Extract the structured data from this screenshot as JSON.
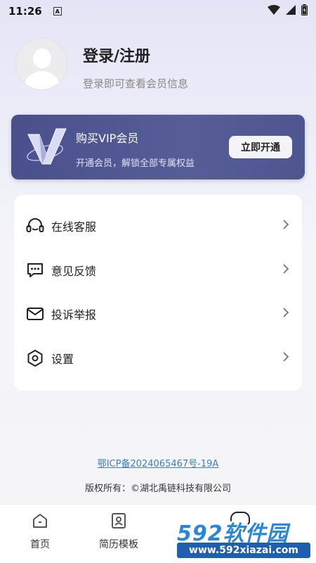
{
  "status_bar": {
    "time": "11:26",
    "a_icon": "A"
  },
  "profile": {
    "title": "登录/注册",
    "subtitle": "登录即可查看会员信息"
  },
  "vip": {
    "title": "购买VIP会员",
    "subtitle": "开通会员，解锁全部专属权益",
    "button_label": "立即开通"
  },
  "menu": {
    "items": [
      {
        "label": "在线客服",
        "icon": "headset-icon"
      },
      {
        "label": "意见反馈",
        "icon": "feedback-icon"
      },
      {
        "label": "投诉举报",
        "icon": "mail-icon"
      },
      {
        "label": "设置",
        "icon": "settings-icon"
      }
    ]
  },
  "footer": {
    "icp": "鄂ICP备2024065467号-19A",
    "copyright": "版权所有：©湖北禹链科技有限公司"
  },
  "bottom_nav": {
    "items": [
      {
        "label": "首页",
        "icon": "home-icon"
      },
      {
        "label": "简历模板",
        "icon": "resume-icon"
      }
    ]
  },
  "watermark": {
    "main": "592软件园",
    "sub": "www.592xiazai.com"
  },
  "colors": {
    "vip_card": "#4d5490",
    "link": "#3a7fc2",
    "watermark_blue": "#2a86d9"
  }
}
